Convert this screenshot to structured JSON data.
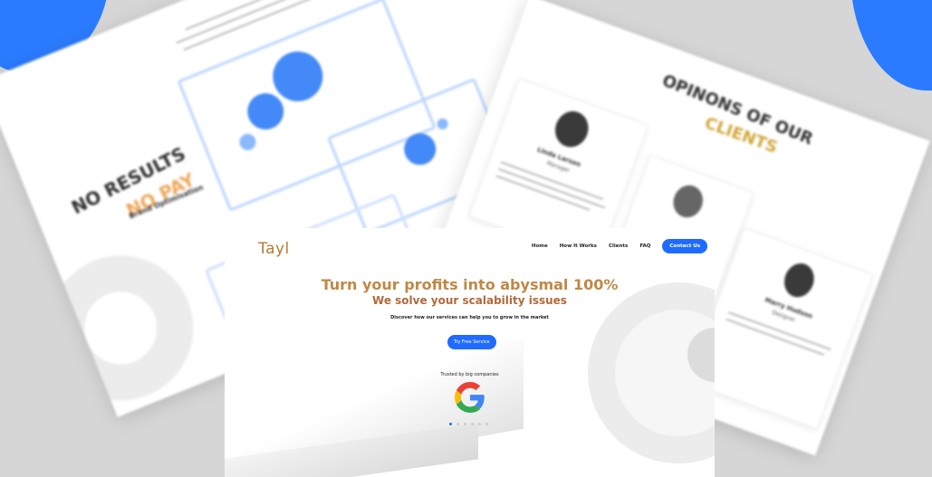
{
  "background": {
    "left_panel": {
      "title_line1": "NO RESULTS",
      "title_line2": "NO PAY",
      "feature_title": "Brand Optimisation"
    },
    "right_panel": {
      "title_line1": "OPINONS OF OUR",
      "title_line2": "CLIENTS",
      "testimonial_1_name": "Linda Larsen",
      "testimonial_1_role": "Manager",
      "testimonial_2_name": "Marry Hudson",
      "testimonial_2_role": "Designer"
    }
  },
  "header": {
    "logo": "Tayl",
    "nav": [
      "Home",
      "How It Works",
      "Clients",
      "FAQ"
    ],
    "cta": "Contact Us"
  },
  "hero": {
    "title": "Turn your profits into abysmal 100%",
    "subtitle": "We solve your scalability issues",
    "description": "Discover how our services can help you to grow in the market",
    "button": "Try Free Service"
  },
  "trusted": {
    "label": "Trusted by big companies",
    "logo_icon": "google-g-icon"
  },
  "carousel": {
    "count": 6,
    "active": 1
  },
  "colors": {
    "accent": "#1f6bff",
    "title": "#c08846",
    "subtitle": "#b06a3c",
    "background": "#d6d6d6",
    "blob": "#2a7bff"
  }
}
